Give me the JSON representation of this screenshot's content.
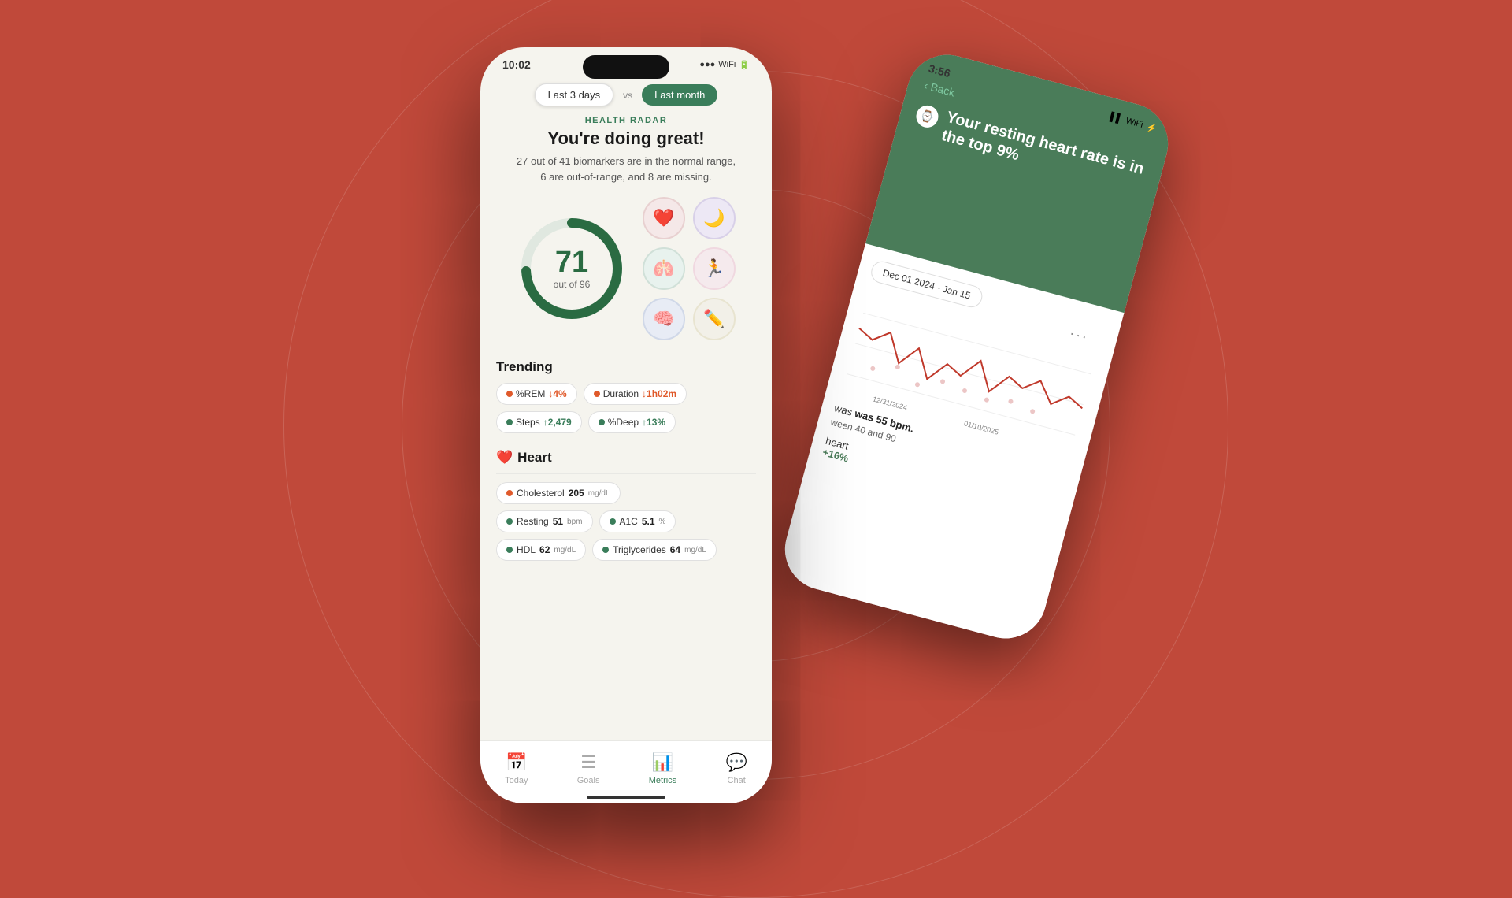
{
  "background": {
    "color": "#c0493a"
  },
  "front_phone": {
    "status_bar": {
      "time": "10:02",
      "signal": "●●●",
      "wifi": "WiFi",
      "battery": "100%"
    },
    "period_toggle": {
      "option1": "Last 3 days",
      "vs": "vs",
      "option2": "Last month",
      "active": "option1"
    },
    "health_radar": {
      "label": "HEALTH RADAR",
      "title": "You're doing great!",
      "subtitle_line1": "27 out of 41 biomarkers are in the normal range,",
      "subtitle_line2": "6 are out-of-range, and 8 are missing."
    },
    "score": {
      "value": "71",
      "label": "out of 96",
      "progress": 0.74
    },
    "categories": [
      {
        "icon": "❤️",
        "color": "#e8d0d0",
        "label": "heart"
      },
      {
        "icon": "🌙",
        "color": "#d8d0e8",
        "label": "sleep"
      },
      {
        "icon": "🫁",
        "color": "#d0e0d8",
        "label": "lungs"
      },
      {
        "icon": "🏃",
        "color": "#f0d8e0",
        "label": "activity"
      },
      {
        "icon": "🧠",
        "color": "#d0d8e8",
        "label": "brain"
      },
      {
        "icon": "✏️",
        "color": "#e8e4d0",
        "label": "edit"
      }
    ],
    "trending": {
      "title": "Trending",
      "tags": [
        {
          "label": "%REM",
          "change": "↓4%",
          "direction": "down",
          "dot_color": "#e05a2b"
        },
        {
          "label": "Duration",
          "change": "↓1h02m",
          "direction": "down",
          "dot_color": "#e05a2b"
        },
        {
          "label": "Steps",
          "change": "↑2,479",
          "direction": "up",
          "dot_color": "#3a7d5a"
        },
        {
          "label": "%Deep",
          "change": "↑13%",
          "direction": "up",
          "dot_color": "#3a7d5a"
        }
      ]
    },
    "heart_section": {
      "title": "Heart",
      "icon": "❤️",
      "metrics": [
        {
          "label": "Cholesterol",
          "value": "205",
          "unit": "mg/dL",
          "dot_color": "#e05a2b"
        },
        {
          "label": "Resting",
          "value": "51",
          "unit": "bpm",
          "dot_color": "#3a7d5a"
        },
        {
          "label": "A1C",
          "value": "5.1",
          "unit": "%",
          "dot_color": "#3a7d5a"
        },
        {
          "label": "HDL",
          "value": "62",
          "unit": "mg/dL",
          "dot_color": "#3a7d5a"
        },
        {
          "label": "Triglycerides",
          "value": "64",
          "unit": "mg/dL",
          "dot_color": "#3a7d5a"
        }
      ]
    },
    "bottom_nav": [
      {
        "label": "Today",
        "icon": "📅",
        "active": false
      },
      {
        "label": "Goals",
        "icon": "☰",
        "active": false
      },
      {
        "label": "Metrics",
        "icon": "📊",
        "active": true
      },
      {
        "label": "Chat",
        "icon": "💬",
        "active": false
      }
    ]
  },
  "back_phone": {
    "status_bar": {
      "time": "3:56"
    },
    "back_btn": "Back",
    "notification": {
      "icon": "⌚",
      "text_line1": "Your resting heart rate is in",
      "text_line2": "the top 9%"
    },
    "date_range": "Dec 01 2024 - Jan 15",
    "chart": {
      "label": "Heart Rate Chart",
      "dates": [
        "12/31/2024",
        "01/10/2025"
      ]
    },
    "stat_text": "was 55 bpm.",
    "range_text": "ween 40 and 90",
    "section_label": "heart",
    "change_value": "+16%",
    "change_value2": "%"
  }
}
